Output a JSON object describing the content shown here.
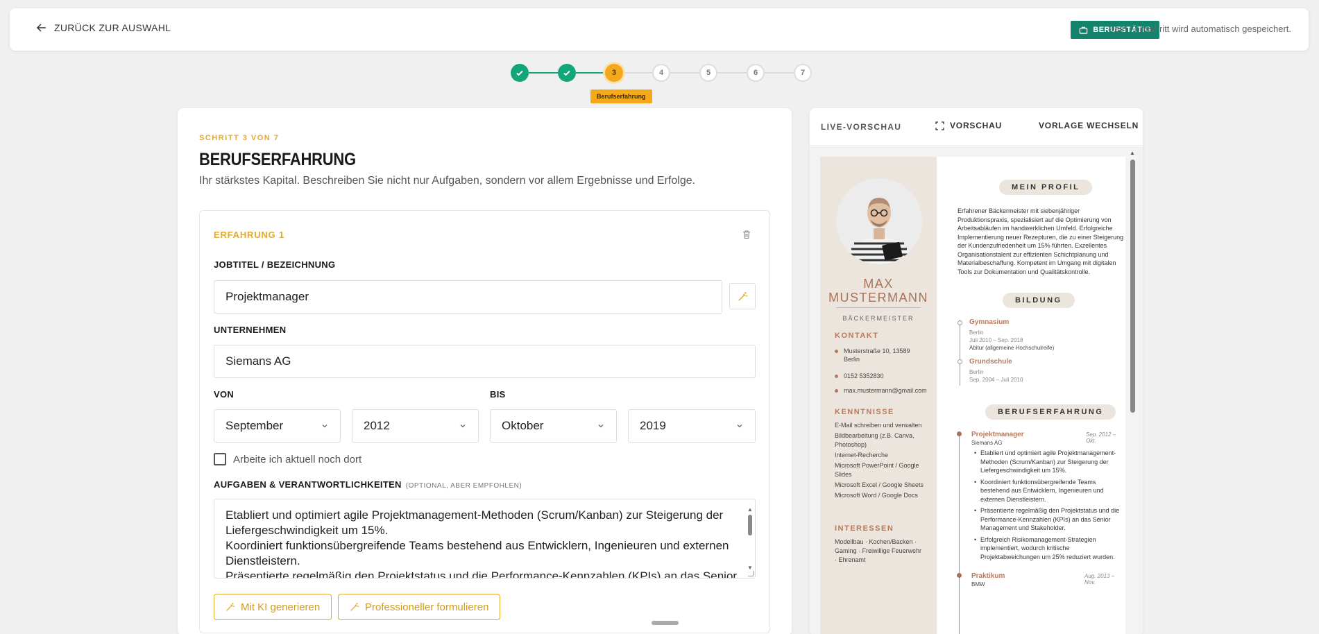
{
  "header": {
    "back_label": "ZURÜCK ZUR AUSWAHL",
    "badge_label": "BERUFSTÄTIG",
    "autosave_text": "Dein Fortschritt wird automatisch gespeichert."
  },
  "stepper": {
    "steps": [
      "1",
      "2",
      "3",
      "4",
      "5",
      "6",
      "7"
    ],
    "current": 3,
    "current_tooltip": "Berufserfahrung"
  },
  "form": {
    "step_label": "SCHRITT 3 VON 7",
    "title": "BERUFSERFAHRUNG",
    "subtitle": "Ihr stärkstes Kapital. Beschreiben Sie nicht nur Aufgaben, sondern vor allem Ergebnisse und Erfolge.",
    "entry_title": "ERFAHRUNG 1",
    "job_label": "JOBTITEL / BEZEICHNUNG",
    "job_value": "Projektmanager",
    "company_label": "UNTERNEHMEN",
    "company_value": "Siemans AG",
    "from_label": "VON",
    "to_label": "BIS",
    "from_month": "September",
    "from_year": "2012",
    "to_month": "Oktober",
    "to_year": "2019",
    "current_checkbox_label": "Arbeite ich aktuell noch dort",
    "tasks_label": "AUFGABEN & VERANTWORTLICHKEITEN",
    "tasks_optional": "(OPTIONAL, ABER EMPFOHLEN)",
    "tasks_lines": [
      "Etabliert und optimiert agile Projektmanagement-Methoden (Scrum/Kanban) zur Steigerung der Liefergeschwindigkeit um 15%.",
      "Koordiniert funktionsübergreifende Teams bestehend aus Entwicklern, Ingenieuren und externen Dienstleistern.",
      "Präsentierte regelmäßig den Projektstatus und die Performance-Kennzahlen (KPIs) an das Senior"
    ],
    "ai_generate_label": "Mit KI generieren",
    "ai_rephrase_label": "Professioneller formulieren"
  },
  "preview": {
    "live_label": "LIVE-VORSCHAU",
    "preview_btn": "VORSCHAU",
    "template_btn": "VORLAGE WECHSELN",
    "cv": {
      "first_name": "MAX",
      "last_name": "MUSTERMANN",
      "role": "BÄCKERMEISTER",
      "contact_heading": "KONTAKT",
      "address_line1": "Musterstraße 10, 13589",
      "address_line2": "Berlin",
      "phone": "0152 5352830",
      "email": "max.mustermann@gmail.com",
      "skills_heading": "KENNTNISSE",
      "skills": [
        "E-Mail schreiben und verwalten",
        "Bildbearbeitung (z.B. Canva, Photoshop)",
        "Internet-Recherche",
        "Microsoft PowerPoint / Google Slides",
        "Microsoft Excel / Google Sheets",
        "Microsoft Word / Google Docs"
      ],
      "interests_heading": "INTERESSEN",
      "interests": "Modellbau · Kochen/Backen · Gaming · Freiwillige Feuerwehr · Ehrenamt",
      "profile_heading": "MEIN PROFIL",
      "profile_text": "Erfahrener Bäckermeister mit siebenjähriger Produktionspraxis, spezialisiert auf die Optimierung von Arbeitsabläufen im handwerklichen Umfeld. Erfolgreiche Implementierung neuer Rezepturen, die zu einer Steigerung der Kundenzufriedenheit um 15% führten. Exzellentes Organisationstalent zur effizienten Schichtplanung und Materialbeschaffung. Kompetent im Umgang mit digitalen Tools zur Dokumentation und Qualitätskontrolle.",
      "education_heading": "BILDUNG",
      "edu1_title": "Gymnasium",
      "edu1_city": "Berlin",
      "edu1_dates": "Juli 2010 – Sep. 2018",
      "edu1_note": "Abitur (allgemeine Hochschulreife)",
      "edu2_title": "Grundschule",
      "edu2_city": "Berlin",
      "edu2_dates": "Sep. 2004 – Juli 2010",
      "experience_heading": "BERUFSERFAHRUNG",
      "job1_title": "Projektmanager",
      "job1_company": "Siemans AG",
      "job1_dates": "Sep. 2012 – Okt.",
      "job1_bullets": [
        "Etabliert und optimiert agile Projektmanagement-Methoden (Scrum/Kanban) zur Steigerung der Liefergeschwindigkeit um 15%.",
        "Koordiniert funktionsübergreifende Teams bestehend aus Entwicklern, Ingenieuren und externen Dienstleistern.",
        "Präsentierte regelmäßig den Projektstatus und die Performance-Kennzahlen (KPIs) an das Senior Management und Stakeholder.",
        "Erfolgreich Risikomanagement-Strategien implementiert, wodurch kritische Projektabweichungen um 25% reduziert wurden."
      ],
      "job2_title": "Praktikum",
      "job2_company": "BMW",
      "job2_dates": "Aug. 2013 – Nov."
    }
  },
  "colors": {
    "accent": "#e4a82b",
    "success": "#13a67b",
    "badge": "#13846b",
    "cv_accent": "#b87a5b"
  }
}
